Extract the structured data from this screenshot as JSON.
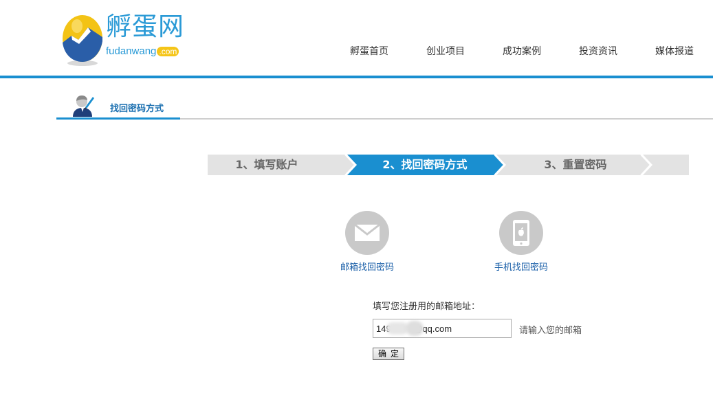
{
  "header": {
    "logo_text": "孵蛋网",
    "logo_sub": "fudanwang",
    "logo_com": ".com",
    "nav": [
      "孵蛋首页",
      "创业项目",
      "成功案例",
      "投资资讯",
      "媒体报道"
    ]
  },
  "section": {
    "title": "找回密码方式"
  },
  "steps": [
    {
      "label": "1、填写账户",
      "state": "done"
    },
    {
      "label": "2、找回密码方式",
      "state": "active"
    },
    {
      "label": "3、重置密码",
      "state": "pending"
    }
  ],
  "options": {
    "email": {
      "label": "邮箱找回密码",
      "icon": "envelope-icon"
    },
    "phone": {
      "label": "手机找回密码",
      "icon": "phone-icon"
    }
  },
  "form": {
    "label": "填写您注册用的邮箱地址：",
    "email_value": "149         @qq.com",
    "hint": "请输入您的邮箱",
    "confirm_label": "确定"
  },
  "colors": {
    "accent": "#1a8fd0",
    "step_active": "#1a8fd0",
    "step_inactive": "#e3e3e3",
    "link": "#1a5fa8"
  }
}
